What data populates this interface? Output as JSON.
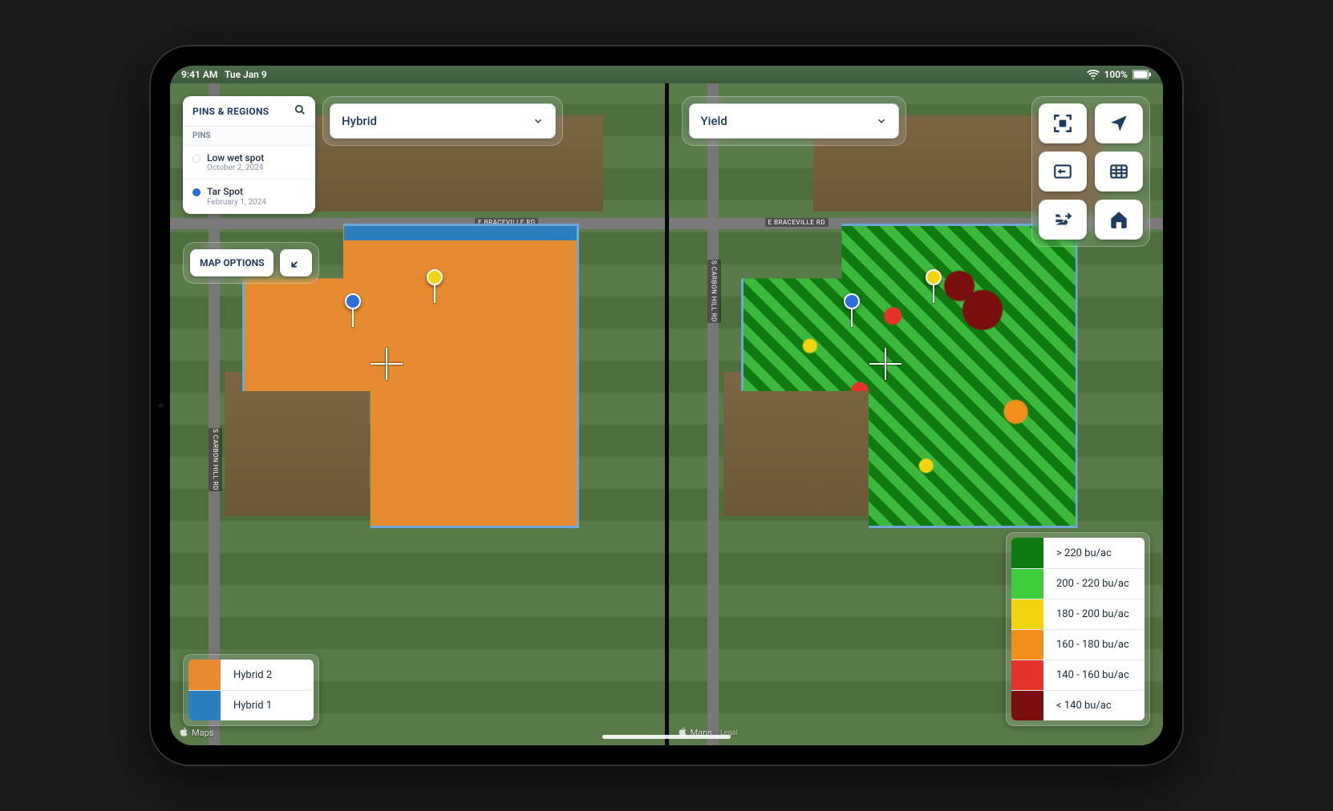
{
  "statusbar": {
    "time": "9:41 AM",
    "date": "Tue Jan 9",
    "battery": "100%"
  },
  "sidebar": {
    "title": "PINS & REGIONS",
    "section": "PINS",
    "pins": [
      {
        "name": "Low wet spot",
        "date": "October 2, 2024",
        "color": "#f2d50f"
      },
      {
        "name": "Tar Spot",
        "date": "February 1, 2024",
        "color": "#2c6fd6"
      }
    ],
    "map_options": "MAP OPTIONS"
  },
  "left_view": {
    "dropdown": "Hybrid",
    "legend_title": null,
    "legend": [
      {
        "color": "#e58a2e",
        "label": "Hybrid 2"
      },
      {
        "color": "#2c7fbf",
        "label": "Hybrid 1"
      }
    ]
  },
  "right_view": {
    "dropdown": "Yield",
    "legend": [
      {
        "color": "#0f7a0f",
        "label": "> 220 bu/ac"
      },
      {
        "color": "#3cce3c",
        "label": "200 - 220 bu/ac"
      },
      {
        "color": "#f2d50f",
        "label": "180 - 200 bu/ac"
      },
      {
        "color": "#f18e1c",
        "label": "160 - 180 bu/ac"
      },
      {
        "color": "#e5332a",
        "label": "140 - 160 bu/ac"
      },
      {
        "color": "#7a0f0f",
        "label": "< 140 bu/ac"
      }
    ]
  },
  "roads": {
    "h_label": "E BRACEVILLE RD",
    "v_label": "S CARBON HILL RD"
  },
  "attribution": {
    "provider": "Maps",
    "legal": "Legal"
  }
}
